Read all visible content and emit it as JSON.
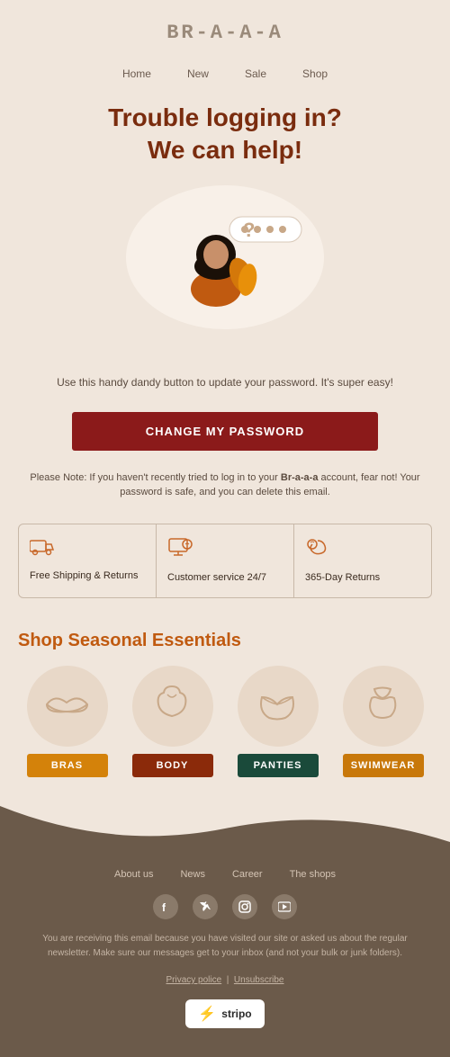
{
  "header": {
    "logo": "BR-A-A-A"
  },
  "nav": {
    "items": [
      {
        "label": "Home",
        "href": "#"
      },
      {
        "label": "New",
        "href": "#"
      },
      {
        "label": "Sale",
        "href": "#"
      },
      {
        "label": "Shop",
        "href": "#"
      }
    ]
  },
  "hero": {
    "title": "Trouble logging in?\nWe can help!"
  },
  "body": {
    "description": "Use this handy dandy button to update your password. It's super easy!",
    "button_label": "CHANGE MY PASSWORD",
    "note": "Please Note: If you haven't recently tried to log in to your Br-a-a-a account, fear not! Your password is safe, and you can delete this email."
  },
  "features": [
    {
      "icon": "truck-icon",
      "icon_char": "🚚",
      "label": "Free Shipping & Returns"
    },
    {
      "icon": "service-icon",
      "icon_char": "🖥",
      "label": "Customer service 24/7"
    },
    {
      "icon": "returns-icon",
      "icon_char": "🎧",
      "label": "365-Day Returns"
    }
  ],
  "seasonal": {
    "title": "Shop Seasonal Essentials",
    "items": [
      {
        "label": "BRAS",
        "badge_class": "badge-bras"
      },
      {
        "label": "BODY",
        "badge_class": "badge-body"
      },
      {
        "label": "PANTIES",
        "badge_class": "badge-panties"
      },
      {
        "label": "SWIMWEAR",
        "badge_class": "badge-swimwear"
      }
    ]
  },
  "footer": {
    "nav_items": [
      {
        "label": "About us",
        "href": "#"
      },
      {
        "label": "News",
        "href": "#"
      },
      {
        "label": "Career",
        "href": "#"
      },
      {
        "label": "The shops",
        "href": "#"
      }
    ],
    "social": [
      {
        "name": "facebook-icon",
        "char": "f"
      },
      {
        "name": "twitter-icon",
        "char": "t"
      },
      {
        "name": "instagram-icon",
        "char": "i"
      },
      {
        "name": "youtube-icon",
        "char": "▶"
      }
    ],
    "disclaimer": "You are receiving this email because you have visited our site or asked us about the regular newsletter. Make sure our messages get to your inbox (and not your bulk or junk folders).",
    "privacy_label": "Privacy police",
    "unsubscribe_label": "Unsubscribe",
    "stripo_label": "stripo"
  },
  "colors": {
    "brand_red": "#7a2c0e",
    "brand_orange": "#c05a10",
    "brand_brown": "#6b5a4a",
    "bg_main": "#f0e6dc"
  }
}
